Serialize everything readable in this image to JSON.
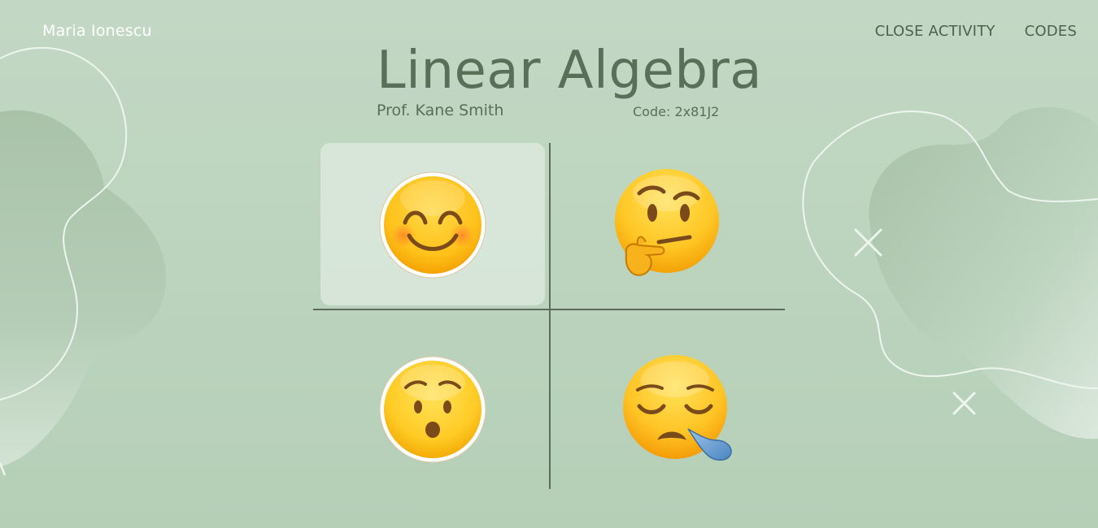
{
  "header": {
    "user_name": "Maria Ionescu",
    "nav": {
      "close_activity": "CLOSE ACTIVITY",
      "codes": "CODES"
    }
  },
  "course": {
    "title": "Linear Algebra",
    "professor": "Prof. Kane Smith",
    "code": "Code: 2x81J2"
  },
  "reactions": [
    {
      "icon": "smiling-face-with-smiling-eyes-icon",
      "selected": true
    },
    {
      "icon": "thinking-face-icon",
      "selected": false
    },
    {
      "icon": "hushed-face-icon",
      "selected": false
    },
    {
      "icon": "sleepy-face-icon",
      "selected": false
    }
  ],
  "colors": {
    "background": "#c3d8c4",
    "text": "#5a6e58",
    "selected_cell": "#e6f0e8"
  }
}
